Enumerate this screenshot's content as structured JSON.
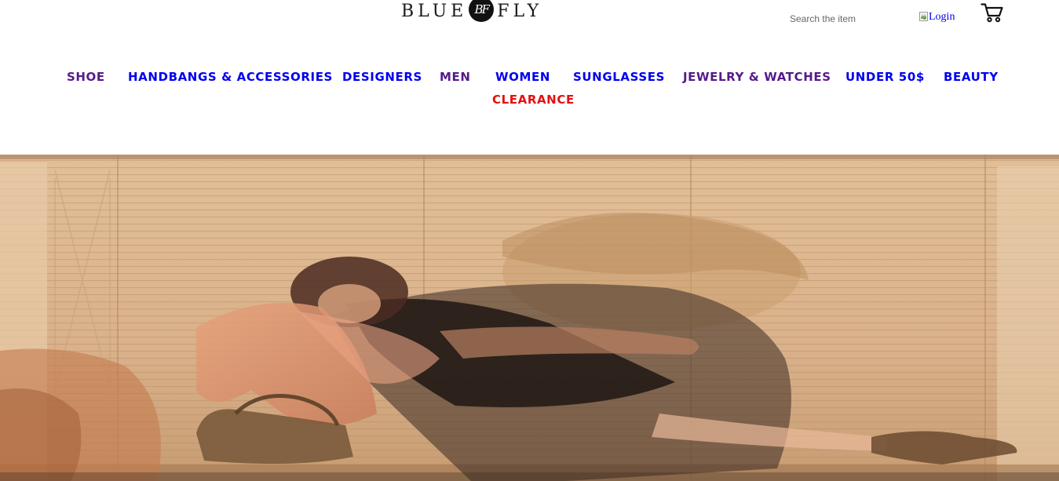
{
  "brand": {
    "name_left": "BLUE",
    "monogram": "BF",
    "name_right": "FLY"
  },
  "search": {
    "placeholder": "Search the item",
    "value": ""
  },
  "login": {
    "alt_text": "Login"
  },
  "icons": {
    "cart": "shopping-cart-icon",
    "broken_image": "broken-image-icon"
  },
  "nav": {
    "items": [
      {
        "label": "SHOE",
        "color": "#551a8b"
      },
      {
        "label": "HANDBANGS & ACCESSORIES",
        "color": "#0000ee"
      },
      {
        "label": "DESIGNERS",
        "color": "#0000ee"
      },
      {
        "label": "MEN",
        "color": "#551a8b"
      },
      {
        "label": "WOMEN",
        "color": "#0000ee"
      },
      {
        "label": "SUNGLASSES",
        "color": "#0000ee"
      },
      {
        "label": "JEWELRY & WATCHES",
        "color": "#551a8b"
      },
      {
        "label": "UNDER 50$",
        "color": "#0000ee"
      },
      {
        "label": "BEAUTY",
        "color": "#0000ee"
      }
    ],
    "highlight": {
      "label": "CLEARANCE",
      "color": "#e31010"
    }
  },
  "colors": {
    "link_unvisited": "#0000ee",
    "link_visited": "#551a8b",
    "clearance": "#e31010",
    "hero_wall": "#d8b08a"
  }
}
